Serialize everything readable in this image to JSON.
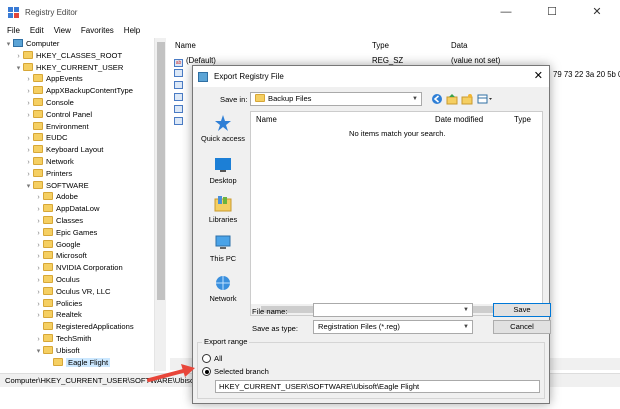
{
  "window": {
    "title": "Registry Editor",
    "minimize": "—",
    "maximize": "☐",
    "close": "✕"
  },
  "menu": [
    "File",
    "Edit",
    "View",
    "Favorites",
    "Help"
  ],
  "tree": [
    {
      "label": "Computer",
      "exp": "▾",
      "icon": "computer",
      "indent": 0
    },
    {
      "label": "HKEY_CLASSES_ROOT",
      "exp": "›",
      "icon": "folder",
      "indent": 1
    },
    {
      "label": "HKEY_CURRENT_USER",
      "exp": "▾",
      "icon": "folder",
      "indent": 1
    },
    {
      "label": "AppEvents",
      "exp": "›",
      "icon": "folder",
      "indent": 2
    },
    {
      "label": "AppXBackupContentType",
      "exp": "›",
      "icon": "folder",
      "indent": 2
    },
    {
      "label": "Console",
      "exp": "›",
      "icon": "folder",
      "indent": 2
    },
    {
      "label": "Control Panel",
      "exp": "›",
      "icon": "folder",
      "indent": 2
    },
    {
      "label": "Environment",
      "exp": "",
      "icon": "folder",
      "indent": 2
    },
    {
      "label": "EUDC",
      "exp": "›",
      "icon": "folder",
      "indent": 2
    },
    {
      "label": "Keyboard Layout",
      "exp": "›",
      "icon": "folder",
      "indent": 2
    },
    {
      "label": "Network",
      "exp": "›",
      "icon": "folder",
      "indent": 2
    },
    {
      "label": "Printers",
      "exp": "›",
      "icon": "folder",
      "indent": 2
    },
    {
      "label": "SOFTWARE",
      "exp": "▾",
      "icon": "folder",
      "indent": 2
    },
    {
      "label": "Adobe",
      "exp": "›",
      "icon": "folder",
      "indent": 3
    },
    {
      "label": "AppDataLow",
      "exp": "›",
      "icon": "folder",
      "indent": 3
    },
    {
      "label": "Classes",
      "exp": "›",
      "icon": "folder",
      "indent": 3
    },
    {
      "label": "Epic Games",
      "exp": "›",
      "icon": "folder",
      "indent": 3
    },
    {
      "label": "Google",
      "exp": "›",
      "icon": "folder",
      "indent": 3
    },
    {
      "label": "Microsoft",
      "exp": "›",
      "icon": "folder",
      "indent": 3
    },
    {
      "label": "NVIDIA Corporation",
      "exp": "›",
      "icon": "folder",
      "indent": 3
    },
    {
      "label": "Oculus",
      "exp": "›",
      "icon": "folder",
      "indent": 3
    },
    {
      "label": "Oculus VR, LLC",
      "exp": "›",
      "icon": "folder",
      "indent": 3
    },
    {
      "label": "Policies",
      "exp": "›",
      "icon": "folder",
      "indent": 3
    },
    {
      "label": "Realtek",
      "exp": "›",
      "icon": "folder",
      "indent": 3
    },
    {
      "label": "RegisteredApplications",
      "exp": "",
      "icon": "folder",
      "indent": 3
    },
    {
      "label": "TechSmith",
      "exp": "›",
      "icon": "folder",
      "indent": 3
    },
    {
      "label": "Ubisoft",
      "exp": "▾",
      "icon": "folder",
      "indent": 3
    },
    {
      "label": "Eagle Flight",
      "exp": "",
      "icon": "folder",
      "indent": 4,
      "selected": true
    }
  ],
  "list": {
    "headers": {
      "name": "Name",
      "type": "Type",
      "data": "Data"
    },
    "rows": [
      {
        "name": "(Default)",
        "type": "REG_SZ",
        "data": "(value not set)"
      },
      {
        "name": "",
        "type": "",
        "data": "79 73 22 3a 20 5b 0"
      }
    ]
  },
  "status": "Computer\\HKEY_CURRENT_USER\\SOFTWARE\\Ubisoft\\Eagle Flight",
  "dialog": {
    "title": "Export Registry File",
    "close": "✕",
    "save_in_label": "Save in:",
    "save_in_value": "Backup Files",
    "places": [
      "Quick access",
      "Desktop",
      "Libraries",
      "This PC",
      "Network"
    ],
    "columns": {
      "name": "Name",
      "date": "Date modified",
      "type": "Type"
    },
    "empty_text": "No items match your search.",
    "file_name_label": "File name:",
    "file_name_value": "",
    "save_as_label": "Save as type:",
    "save_as_value": "Registration Files (*.reg)",
    "save_button": "Save",
    "cancel_button": "Cancel",
    "export_range_label": "Export range",
    "radio_all": "All",
    "radio_selected": "Selected branch",
    "branch_path": "HKEY_CURRENT_USER\\SOFTWARE\\Ubisoft\\Eagle Flight"
  },
  "colors": {
    "accent": "#0078d7",
    "annotation_arrow": "#e8463a",
    "folder": "#f5cf62",
    "selected_row": "#cce8ff"
  }
}
